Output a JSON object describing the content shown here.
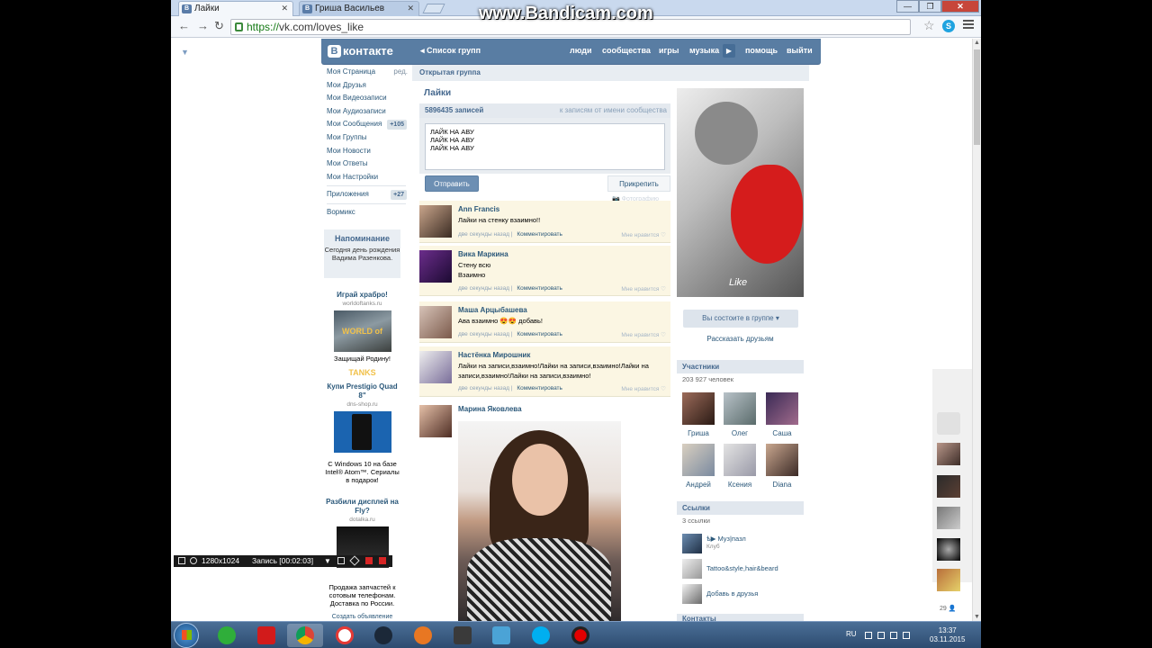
{
  "browser": {
    "tabs": [
      {
        "label": "Лайки",
        "favicon": "В"
      },
      {
        "label": "Гриша Васильев",
        "favicon": "В"
      }
    ],
    "window_controls": {
      "minimize": "—",
      "maximize": "❐",
      "close": "✕"
    },
    "url_scheme": "https://",
    "url_rest": "vk.com/loves_like"
  },
  "overlay": {
    "watermark": "www.Bandicam.com",
    "rec_resolution": "1280x1024",
    "rec_time": "Запись [00:02:03]"
  },
  "vk": {
    "logo": "контакте",
    "logo_badge": "В",
    "group_list_link": "Список групп",
    "nav": [
      "люди",
      "сообщества",
      "игры",
      "музыка",
      "помощь",
      "выйти"
    ],
    "left_menu": [
      {
        "label": "Моя Страница",
        "extra": "ред."
      },
      {
        "label": "Мои Друзья"
      },
      {
        "label": "Мои Видеозаписи"
      },
      {
        "label": "Мои Аудиозаписи"
      },
      {
        "label": "Мои Сообщения",
        "badge": "+105"
      },
      {
        "label": "Мои Группы"
      },
      {
        "label": "Мои Новости"
      },
      {
        "label": "Мои Ответы"
      },
      {
        "label": "Мои Настройки"
      }
    ],
    "apps": {
      "label": "Приложения",
      "badge": "+27"
    },
    "wormix": "Вормикс",
    "reminder": {
      "title": "Напоминание",
      "text": "Сегодня день рождения Вадима Разенкова."
    },
    "ads": [
      {
        "title": "Играй храбро!",
        "domain": "worldoftanks.ru",
        "img": "WORLD of TANKS",
        "text": "Защищай Родину!"
      },
      {
        "title": "Купи Prestigio Quad 8\"",
        "domain": "dns-shop.ru",
        "text": "С Windows 10 на базе Intel® Atom™. Сериалы в подарок!"
      },
      {
        "title": "Разбили дисплей на Fly?",
        "domain": "dotalka.ru"
      },
      {
        "text": "Продажа запчастей к сотовым телефонам. Доставка по России.",
        "footer": "Создать объявление"
      }
    ],
    "group": {
      "type": "Открытая группа",
      "title": "Лайки",
      "posts_count": "5896435 записей",
      "to_posts": "к записям от имени сообщества",
      "draft_lines": [
        "ЛАЙК НА АВУ",
        "ЛАЙК НА АВУ",
        "ЛАЙК НА АВУ"
      ],
      "send": "Отправить",
      "attach": "Прикрепить",
      "attach_photo": "Фотографию"
    },
    "posts": [
      {
        "name": "Ann Francis",
        "text": "Лайки на стенку взаимно!!",
        "time": "две секунды назад",
        "comment": "Комментировать",
        "like": "Мне нравится ♡"
      },
      {
        "name": "Вика Маркина",
        "text": "Стену всю\nВзаимно",
        "time": "две секунды назад",
        "comment": "Комментировать",
        "like": "Мне нравится ♡"
      },
      {
        "name": "Маша Арцыбашева",
        "text": "Ава взаимно 😍😍 добавь!",
        "time": "две секунды назад",
        "comment": "Комментировать",
        "like": "Мне нравится ♡"
      },
      {
        "name": "Настёнка Мирошник",
        "text": "Лайки на записи,взаимно!Лайки на записи,взаимно!Лайки на записи,взаимно!Лайки на записи,взаимно!",
        "time": "две секунды назад",
        "comment": "Комментировать",
        "like": "Мне нравится ♡"
      },
      {
        "name": "Марина Яковлева"
      }
    ],
    "right": {
      "image_caption": "Like",
      "member_btn": "Вы состоите в группе ▾",
      "tell_friends": "Рассказать друзьям",
      "members_title": "Участники",
      "members_count": "203 927 человек",
      "members": [
        "Гриша",
        "Олег",
        "Саша",
        "Андрей",
        "Ксения",
        "Diana"
      ],
      "links_title": "Ссылки",
      "links_count": "3 ссылки",
      "links": [
        {
          "title": "ѣ▶ Муз|пазл",
          "sub": "Клуб"
        },
        {
          "title": "Tattoo&style,hair&beard"
        },
        {
          "title": "Добавь в друзья"
        }
      ],
      "contacts_title": "Контакты"
    },
    "side_counter": "29"
  },
  "taskbar": {
    "lang": "RU",
    "time": "13:37",
    "date": "03.11.2015"
  }
}
